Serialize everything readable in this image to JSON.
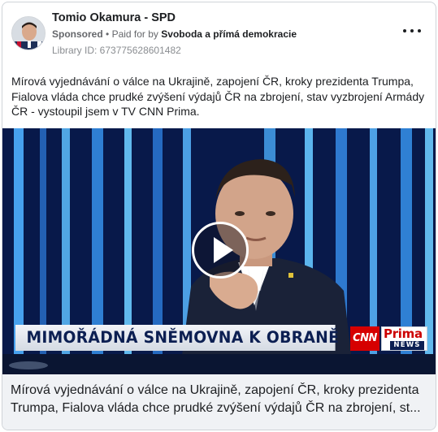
{
  "post": {
    "page_name": "Tomio Okamura - SPD",
    "sponsored_label": "Sponsored",
    "separator": "•",
    "paid_for_by_label": "Paid for by",
    "payer": "Svoboda a přímá demokracie",
    "library_id": "Library ID: 673775628601482",
    "caption": "Mírová vyjednávání o válce na Ukrajině, zapojení ČR, kroky prezidenta Trumpa, Fialova vláda chce prudké zvýšení výdajů ČR na zbrojení, stav vyzbrojení Armády ČR - vystoupil jsem v TV CNN Prima."
  },
  "video": {
    "banner_text": "MIMOŘÁDNÁ SNĚMOVNA K OBRANĚ",
    "logo_cnn": "CNN",
    "logo_prima": "Prima",
    "logo_news": "NEWS",
    "play_icon": "play-icon"
  },
  "footer": {
    "line1": "Mírová vyjednávání o válce na Ukrajině, zapojení ČR, kroky prezidenta",
    "line2": "Trumpa, Fialova vláda chce prudké zvýšení výdajů ČR na zbrojení, st..."
  },
  "icons": {
    "more": "more-options-icon",
    "avatar": "page-avatar"
  },
  "colors": {
    "banner_text": "#0c1f52",
    "cnn_red": "#d60000",
    "footer_bg": "#f0f2f5"
  }
}
